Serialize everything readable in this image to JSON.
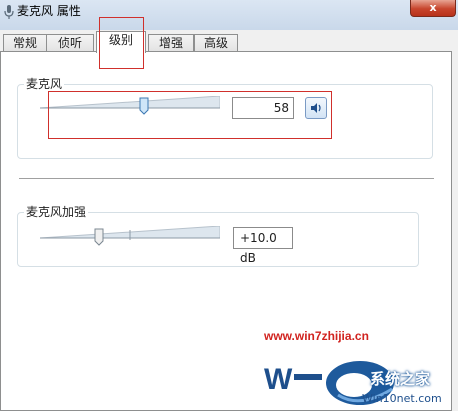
{
  "window": {
    "title": "麦克风 属性",
    "close_label": "x"
  },
  "tabs": [
    {
      "label": "常规",
      "active": false
    },
    {
      "label": "侦听",
      "active": false
    },
    {
      "label": "级别",
      "active": true
    },
    {
      "label": "增强",
      "active": false
    },
    {
      "label": "高级",
      "active": false
    }
  ],
  "microphone": {
    "group_label": "麦克风",
    "value": "58",
    "level_percent": 58
  },
  "boost": {
    "group_label": "麦克风加强",
    "value": "+10.0 dB",
    "level_percent": 33
  },
  "watermark": {
    "url": "www.win7zhijia.cn",
    "brand": "系统之家",
    "site": "Win10net.com"
  },
  "colors": {
    "highlight_red": "#d0302c",
    "watermark_red": "#d1231f",
    "logo_blue": "#1e5a9c"
  }
}
